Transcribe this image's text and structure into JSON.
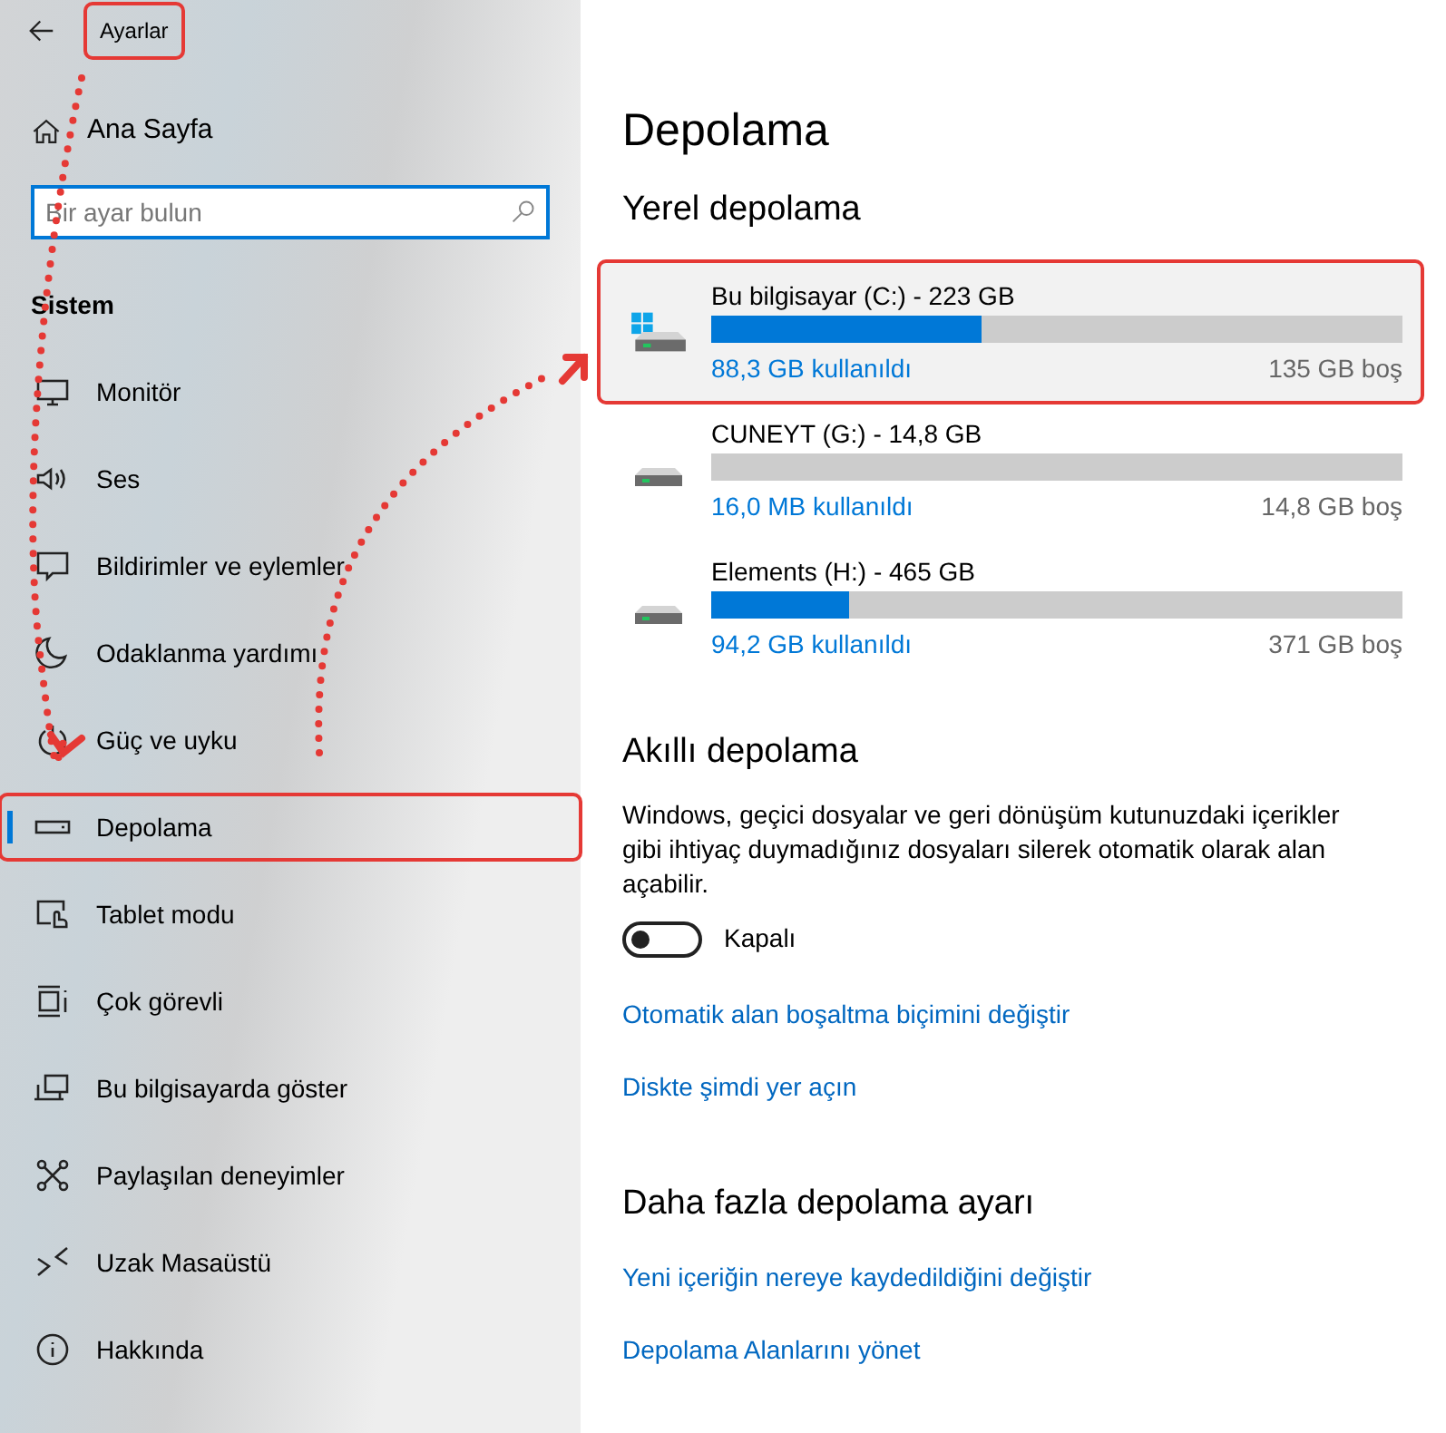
{
  "sidebar": {
    "title": {
      "text": "Ayarlar",
      "highlighted": true
    },
    "home": "Ana Sayfa",
    "search": {
      "placeholder": "Bir ayar bulun"
    },
    "section": "Sistem",
    "items": [
      {
        "label": "Monitör",
        "selected": false,
        "highlighted": false
      },
      {
        "label": "Ses",
        "selected": false,
        "highlighted": false
      },
      {
        "label": "Bildirimler ve eylemler",
        "selected": false,
        "highlighted": false
      },
      {
        "label": "Odaklanma yardımı",
        "selected": false,
        "highlighted": false
      },
      {
        "label": "Güç ve uyku",
        "selected": false,
        "highlighted": false
      },
      {
        "label": "Depolama",
        "selected": true,
        "highlighted": true
      },
      {
        "label": "Tablet modu",
        "selected": false,
        "highlighted": false
      },
      {
        "label": "Çok görevli",
        "selected": false,
        "highlighted": false
      },
      {
        "label": "Bu bilgisayarda göster",
        "selected": false,
        "highlighted": false
      },
      {
        "label": "Paylaşılan deneyimler",
        "selected": false,
        "highlighted": false
      },
      {
        "label": "Uzak Masaüstü",
        "selected": false,
        "highlighted": false
      },
      {
        "label": "Hakkında",
        "selected": false,
        "highlighted": false
      }
    ]
  },
  "main": {
    "title": "Depolama",
    "local_heading": "Yerel depolama",
    "drives": [
      {
        "kind": "system",
        "name": "Bu bilgisayar (C:) - 223 GB",
        "level": 0.39,
        "used": "88,3 GB kullanıldı",
        "free": "135 GB boş",
        "highlighted": true
      },
      {
        "kind": "removable",
        "name": "CUNEYT (G:) - 14,8 GB",
        "level": 0,
        "used": "16,0 MB kullanıldı",
        "free": "14,8 GB boş",
        "highlighted": false
      },
      {
        "kind": "removable",
        "name": "Elements (H:) - 465 GB",
        "level": 0.2,
        "used": "94,2 GB kullanıldı",
        "free": "371 GB boş",
        "highlighted": false
      }
    ],
    "smart": {
      "heading": "Akıllı depolama",
      "description": "Windows, geçici dosyalar ve geri dönüşüm kutunuzdaki içerikler gibi ihtiyaç duymadığınız dosyaları silerek otomatik olarak alan açabilir.",
      "toggle": {
        "on": false,
        "label": "Kapalı"
      },
      "links": [
        "Otomatik alan boşaltma biçimini değiştir",
        "Diskte şimdi yer açın"
      ]
    },
    "more": {
      "heading": "Daha fazla depolama ayarı",
      "links": [
        "Yeni içeriğin nereye kaydedildiğini değiştir",
        "Depolama Alanlarını yönet"
      ]
    }
  }
}
